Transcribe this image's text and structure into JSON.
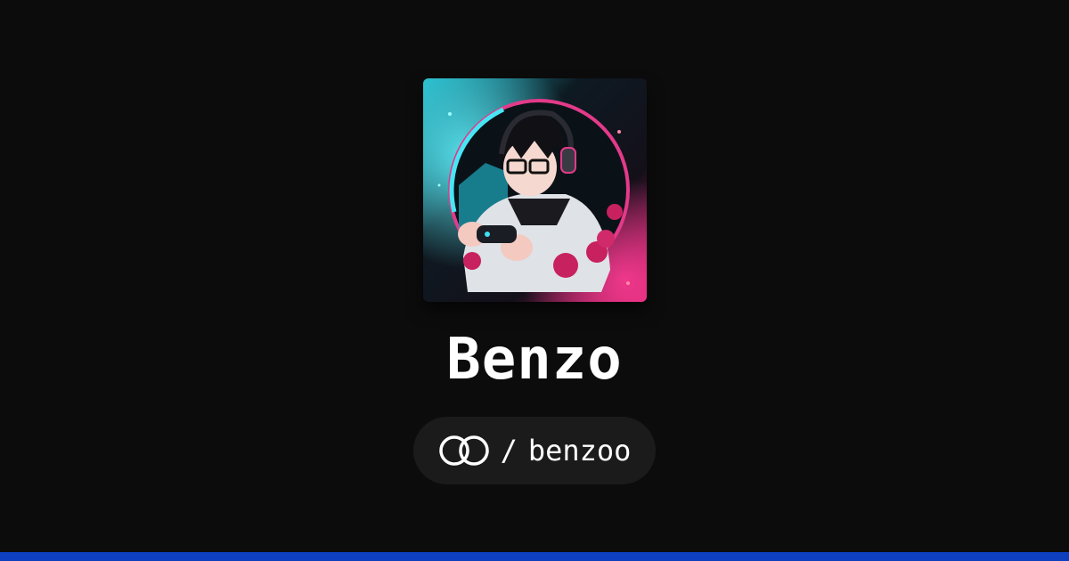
{
  "profile": {
    "display_name": "Benzo",
    "separator": "/",
    "username": "benzoo",
    "platform_icon": "linked-rings-icon",
    "avatar_icon": "gamer-avatar-image"
  },
  "colors": {
    "background": "#0c0c0c",
    "pill_background": "#1b1b1b",
    "text": "#ffffff",
    "accent_bar": "#0d3fbf",
    "avatar_cyan": "#3fe0f0",
    "avatar_pink": "#ff2f8f"
  }
}
